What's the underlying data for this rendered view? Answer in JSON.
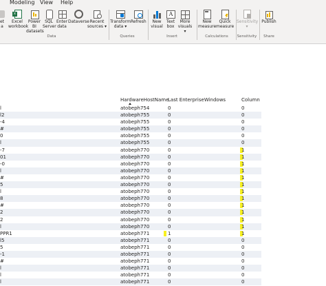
{
  "menu": {
    "tabs": [
      "Modeling",
      "View",
      "Help"
    ]
  },
  "ribbon": {
    "data_group": {
      "label": "Data",
      "buttons": [
        {
          "line1": "et",
          "line2": "a"
        },
        {
          "line1": "Excel",
          "line2": "workbook"
        },
        {
          "line1": "Power BI",
          "line2": "datasets"
        },
        {
          "line1": "SQL",
          "line2": "Server"
        },
        {
          "line1": "Enter",
          "line2": "data"
        },
        {
          "line1": "Dataverse",
          "line2": ""
        },
        {
          "line1": "Recent",
          "line2": "sources ▾"
        }
      ]
    },
    "queries_group": {
      "label": "Queries",
      "buttons": [
        {
          "line1": "Transform",
          "line2": "data ▾"
        },
        {
          "line1": "Refresh",
          "line2": ""
        }
      ]
    },
    "insert_group": {
      "label": "Insert",
      "buttons": [
        {
          "line1": "New",
          "line2": "visual"
        },
        {
          "line1": "Text",
          "line2": "box"
        },
        {
          "line1": "More",
          "line2": "visuals ▾"
        }
      ]
    },
    "calculations_group": {
      "label": "Calculations",
      "buttons": [
        {
          "line1": "New",
          "line2": "measure"
        },
        {
          "line1": "Quick",
          "line2": "measure"
        }
      ]
    },
    "sensitivity_group": {
      "label": "Sensitivity",
      "buttons": [
        {
          "line1": "Sensitivity",
          "line2": "▾"
        }
      ]
    },
    "share_group": {
      "label": "Share",
      "buttons": [
        {
          "line1": "Publish",
          "line2": ""
        }
      ]
    }
  },
  "table": {
    "headers": [
      "HardwareHostName",
      "Last EnterpriseWindows",
      "Column"
    ],
    "rows": [
      {
        "c0": "l",
        "host": "atobeph754",
        "last": "0",
        "col": "0"
      },
      {
        "c0": "l2",
        "host": "atobeph755",
        "last": "0",
        "col": "0"
      },
      {
        "c0": "-4",
        "host": "atobeph755",
        "last": "0",
        "col": "0"
      },
      {
        "c0": "#",
        "host": "atobeph755",
        "last": "0",
        "col": "0"
      },
      {
        "c0": "0",
        "host": "atobeph755",
        "last": "0",
        "col": "0"
      },
      {
        "c0": "l",
        "host": "atobeph755",
        "last": "0",
        "col": "0"
      },
      {
        "c0": "-7",
        "host": "atobeph770",
        "last": "0",
        "col": "1"
      },
      {
        "c0": "01",
        "host": "atobeph770",
        "last": "0",
        "col": "1"
      },
      {
        "c0": "-0",
        "host": "atobeph770",
        "last": "0",
        "col": "1"
      },
      {
        "c0": "l",
        "host": "atobeph770",
        "last": "0",
        "col": "1"
      },
      {
        "c0": "#",
        "host": "atobeph770",
        "last": "0",
        "col": "1"
      },
      {
        "c0": "5",
        "host": "atobeph770",
        "last": "0",
        "col": "1"
      },
      {
        "c0": "l",
        "host": "atobeph770",
        "last": "0",
        "col": "1"
      },
      {
        "c0": "8",
        "host": "atobeph770",
        "last": "0",
        "col": "1"
      },
      {
        "c0": "#",
        "host": "atobeph770",
        "last": "0",
        "col": "1"
      },
      {
        "c0": "2",
        "host": "atobeph770",
        "last": "0",
        "col": "1"
      },
      {
        "c0": "2",
        "host": "atobeph770",
        "last": "0",
        "col": "1"
      },
      {
        "c0": "l",
        "host": "atobeph770",
        "last": "0",
        "col": "1"
      },
      {
        "c0": "PPR1",
        "host": "atobeph771",
        "last": "1",
        "col": "1"
      },
      {
        "c0": "l5",
        "host": "atobeph771",
        "last": "0",
        "col": "0"
      },
      {
        "c0": "5",
        "host": "atobeph771",
        "last": "0",
        "col": "0"
      },
      {
        "c0": "-1",
        "host": "atobeph771",
        "last": "0",
        "col": "0"
      },
      {
        "c0": "#",
        "host": "atobeph771",
        "last": "0",
        "col": "0"
      },
      {
        "c0": "l",
        "host": "atobeph771",
        "last": "0",
        "col": "0"
      },
      {
        "c0": "l",
        "host": "atobeph771",
        "last": "0",
        "col": "0"
      },
      {
        "c0": "l",
        "host": "atobeph771",
        "last": "0",
        "col": "0"
      }
    ]
  },
  "colors": {
    "highlight": "#f7f021",
    "alt_row": "#edf0f5",
    "ribbon_bg": "#f3f2f1"
  }
}
